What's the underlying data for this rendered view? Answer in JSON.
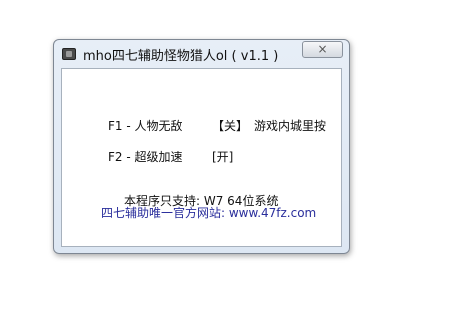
{
  "window": {
    "title": "mho四七辅助怪物猎人ol ( v1.1 )",
    "close_icon": "×"
  },
  "hotkeys": [
    {
      "key": "F1 - 人物无敌",
      "state": "【关】",
      "extra": "游戏内城里按"
    },
    {
      "key": "F2 - 超级加速",
      "state": "[开]"
    }
  ],
  "support_text": "本程序只支持: W7 64位系统",
  "website_text": "四七辅助唯一官方网站: www.47fz.com",
  "colors": {
    "link": "#2a2e9c"
  }
}
